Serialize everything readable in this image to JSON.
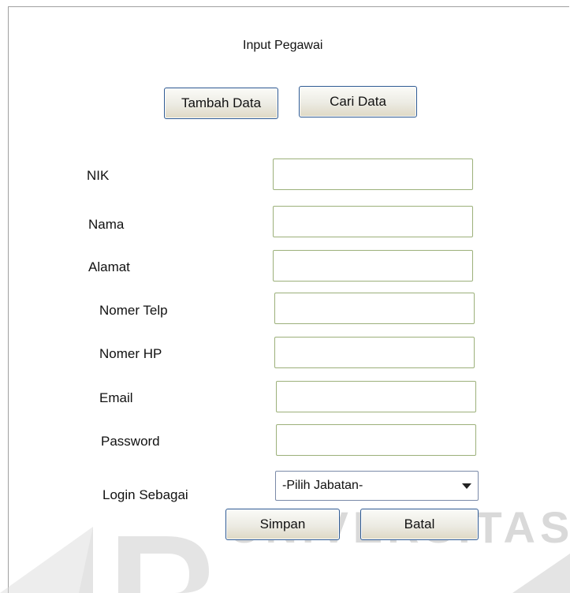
{
  "form": {
    "title": "Input Pegawai",
    "buttons": {
      "tambah_label": "Tambah Data",
      "cari_label": "Cari Data",
      "simpan_label": "Simpan",
      "batal_label": "Batal"
    },
    "fields": {
      "nik_label": "NIK",
      "nama_label": "Nama",
      "alamat_label": "Alamat",
      "telp_label": "Nomer Telp",
      "hp_label": "Nomer HP",
      "email_label": "Email",
      "password_label": "Password",
      "login_label": "Login Sebagai",
      "nik_value": "",
      "nama_value": "",
      "alamat_value": "",
      "telp_value": "",
      "hp_value": "",
      "email_value": "",
      "password_value": ""
    },
    "jabatan": {
      "selected": "-Pilih Jabatan-"
    }
  },
  "watermark": {
    "text": "UNIVERSITAS"
  }
}
